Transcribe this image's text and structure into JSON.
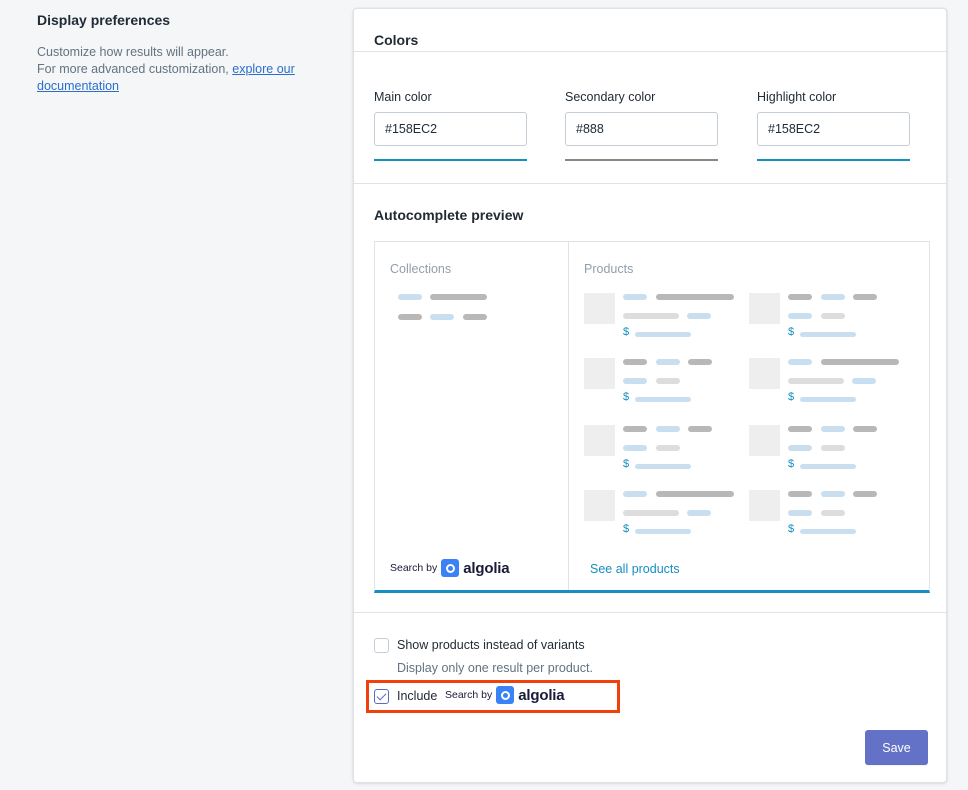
{
  "sidebar": {
    "title": "Display preferences",
    "description_line1": "Customize how results will appear.",
    "description_line2": "For more advanced customization,",
    "link_text": "explore our documentation"
  },
  "colors_section": {
    "title": "Colors",
    "fields": [
      {
        "label": "Main color",
        "value": "#158EC2",
        "swatch": "#158ec2"
      },
      {
        "label": "Secondary color",
        "value": "#888",
        "swatch": "#888888"
      },
      {
        "label": "Highlight color",
        "value": "#158EC2",
        "swatch": "#158ec2"
      }
    ]
  },
  "preview": {
    "title": "Autocomplete preview",
    "collections_heading": "Collections",
    "products_heading": "Products",
    "dollar": "$",
    "search_by_text": "Search by",
    "algolia_word": "algolia",
    "see_all": "See all products"
  },
  "options": {
    "show_products_label": "Show products instead of variants",
    "show_products_help": "Display only one result per product.",
    "show_products_checked": false,
    "include_label": "Include",
    "include_checked": true,
    "search_by_text": "Search by",
    "algolia_word": "algolia"
  },
  "actions": {
    "save_label": "Save"
  },
  "colors": {
    "accent": "#158ec2",
    "primary_button": "#6371c7",
    "highlight_frame": "#f0400b"
  }
}
